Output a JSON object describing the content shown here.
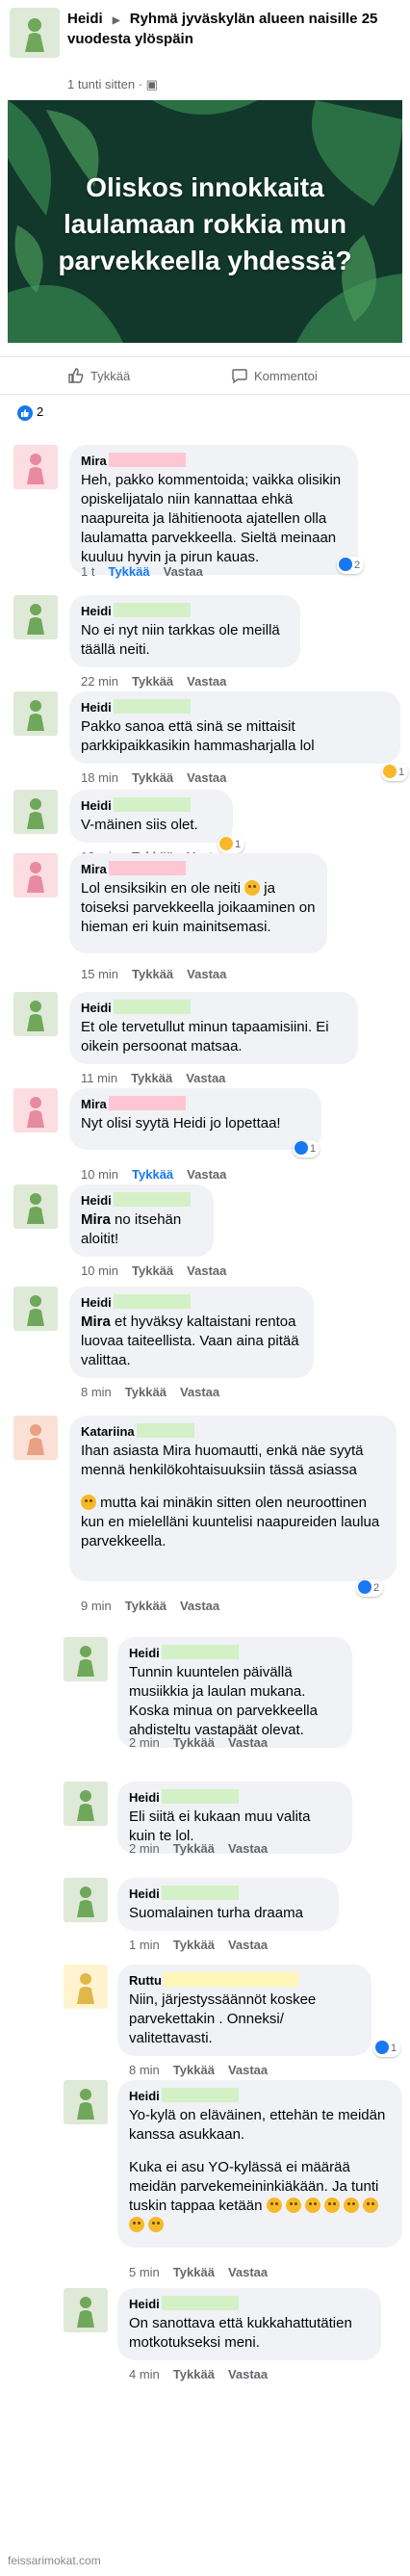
{
  "post": {
    "author": "Heidi",
    "group": "Ryhmä jyväskylän alueen naisille 25 vuodesta ylöspäin",
    "time": "1 tunti sitten",
    "image_text": "Oliskos innokkaita laulamaan rokkia mun parvekkeella yhdessä?",
    "like_label": "Tykkää",
    "comment_label": "Kommentoi",
    "reaction_count": "2"
  },
  "colors": {
    "heidi_avatar": "#dfe9d8",
    "mira_avatar": "#fbdde2",
    "katariina_avatar": "#fbe0d6",
    "ruttu_avatar": "#fff4cf",
    "redact_green": "#d3f0c7",
    "redact_pink": "#fcc7d3",
    "redact_yellow": "#fff6b8",
    "accent": "#1877f2"
  },
  "labels": {
    "like": "Tykkää",
    "reply": "Vastaa"
  },
  "comments": [
    {
      "author": "Mira",
      "text": "Heh, pakko kommentoida; vaikka olisikin opiskelijatalo niin kannattaa ehkä naapureita ja lähitienoota ajatellen olla laulamatta parvekkeella. Sieltä meinaan kuuluu hyvin ja pirun kauas.",
      "time": "1 t",
      "reactions": "2"
    },
    {
      "author": "Heidi",
      "text": "No ei nyt niin tarkkas ole meillä täällä neiti.",
      "time": "22 min"
    },
    {
      "author": "Heidi",
      "text": "Pakko sanoa että sinä se mittaisit parkkipaikkasikin hammasharjalla lol",
      "time": "18 min",
      "reactions": "1"
    },
    {
      "author": "Heidi",
      "text": "V-mäinen siis olet.",
      "time": "12 min",
      "reactions": "1"
    },
    {
      "author": "Mira",
      "text": "Lol ensiksikin en ole neiti",
      "text_b": "ja toiseksi parvekkeella joikaaminen on hieman eri kuin mainitsemasi.",
      "time": "15 min"
    },
    {
      "author": "Heidi",
      "text": "Et ole tervetullut minun tapaamisiini. Ei oikein persoonat matsaa.",
      "time": "11 min"
    },
    {
      "author": "Mira",
      "text": "Nyt olisi syytä Heidi jo lopettaa!",
      "time": "10 min",
      "reactions": "1"
    },
    {
      "author": "Heidi",
      "mention": "Mira",
      "text": "no itsehän aloitit!",
      "time": "10 min"
    },
    {
      "author": "Heidi",
      "mention": "Mira",
      "text": "et hyväksy kaltaistani rentoa luovaa taiteellista. Vaan aina pitää valittaa.",
      "time": "8 min"
    },
    {
      "author": "Katariina",
      "text": "Ihan asiasta Mira huomautti, enkä näe syytä mennä henkilökohtaisuuksiin tässä asiassa",
      "text_b": "mutta kai minäkin sitten olen neuroottinen kun en mielelläni kuuntelisi naapureiden laulua parvekkeella.",
      "time": "9 min",
      "reactions": "2"
    },
    {
      "author": "Heidi",
      "text": "Tunnin kuuntelen päivällä musiikkia ja laulan mukana. Koska minua on parvekkeella ahdisteltu vastapäät olevat.",
      "time": "2 min"
    },
    {
      "author": "Heidi",
      "text": "Eli siitä ei kukaan muu valita kuin te lol.",
      "time": "2 min"
    },
    {
      "author": "Heidi",
      "text": "Suomalainen turha draama",
      "time": "1 min"
    },
    {
      "author": "Ruttu",
      "text": "Niin, järjestyssäännöt koskee parvekettakin . Onneksi/ valitettavasti.",
      "time": "8 min",
      "reactions": "1"
    },
    {
      "author": "Heidi",
      "text": "Yo-kylä on eläväinen, ettehän te meidän kanssa asukkaan.",
      "text_b": "Kuka ei asu YO-kylässä ei määrää meidän parvekemeininkiäkään. Ja tunti tuskin tappaa ketään",
      "time": "5 min"
    },
    {
      "author": "Heidi",
      "text": "On sanottava että kukkahattutätien motkotukseksi meni.",
      "time": "4 min"
    }
  ],
  "watermark": "feissarimokat.com"
}
